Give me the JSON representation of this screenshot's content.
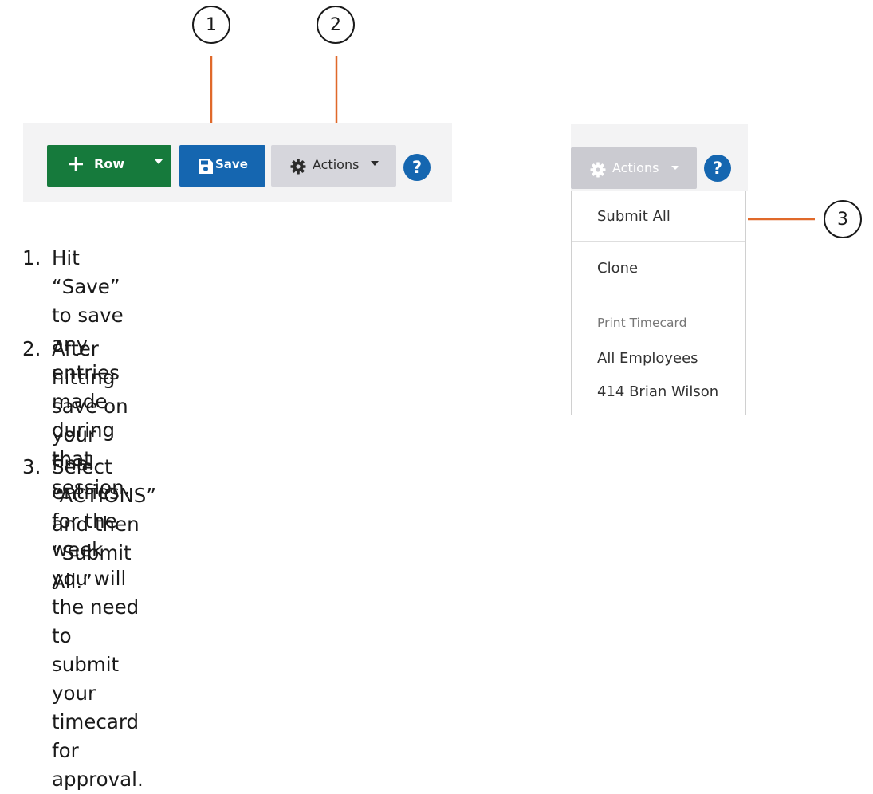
{
  "callouts": [
    "1",
    "2",
    "3"
  ],
  "toolbar": {
    "row_label": "Row",
    "save_label": "Save",
    "actions_label": "Actions",
    "help_label": "?"
  },
  "instructions": [
    {
      "num": "1.",
      "text": "Hit “Save” to save any entries made\nduring that session."
    },
    {
      "num": "2.",
      "text": "After hitting save on your final entries\nfor the week you will the need to\nsubmit your timecard for approval."
    },
    {
      "num": "3.",
      "text": "Select “ACTIONS” and then “Submit\nAll.”"
    }
  ],
  "dropdown": {
    "actions_label": "Actions",
    "help_label": "?",
    "items": [
      "Submit All",
      "Clone"
    ],
    "section_header": "Print Timecard",
    "print_items": [
      "All Employees",
      "414 Brian Wilson"
    ]
  },
  "colors": {
    "add_row_button": "#167a3c",
    "save_button": "#1566b0",
    "actions_button": "#d6d6dc",
    "arrow": "#e0692a"
  },
  "icons": [
    "plus-icon",
    "chevron-down-icon",
    "floppy-disk-icon",
    "gear-icon",
    "help-icon"
  ]
}
